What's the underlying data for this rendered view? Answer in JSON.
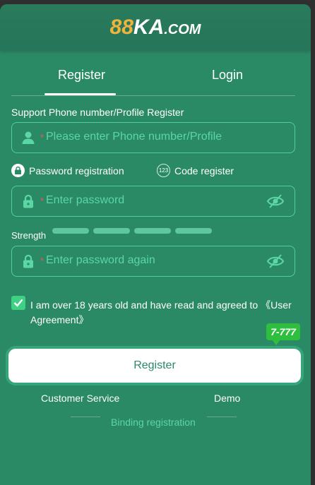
{
  "brand": {
    "num": "88",
    "name": "KA",
    "tld": ".COM"
  },
  "tabs": [
    {
      "label": "Register",
      "active": true
    },
    {
      "label": "Login",
      "active": false
    }
  ],
  "form": {
    "support_label": "Support Phone number/Profile Register",
    "phone_placeholder": "Please enter Phone number/Profile",
    "required_mark": "*",
    "mode_password": {
      "label": "Password registration",
      "icon": "lock-icon",
      "selected": true
    },
    "mode_code": {
      "label": "Code register",
      "icon": "123-icon",
      "icon_text": "123",
      "selected": false
    },
    "password_placeholder": "Enter password",
    "strength_label": "Strength",
    "strength_level": 0,
    "confirm_placeholder": "Enter password again",
    "agreement_text": "I am over 18 years old and have read and agreed to 《User Agreement》",
    "agreement_checked": true,
    "submit_label": "Register"
  },
  "badge": "7-777",
  "links": {
    "customer_service": "Customer Service",
    "demo": "Demo"
  },
  "binding": "Binding registration",
  "colors": {
    "panel": "#2b8a66",
    "accent": "#4fcf9c",
    "logo_gold": "#f2b33d",
    "required": "#ff4d4d"
  }
}
